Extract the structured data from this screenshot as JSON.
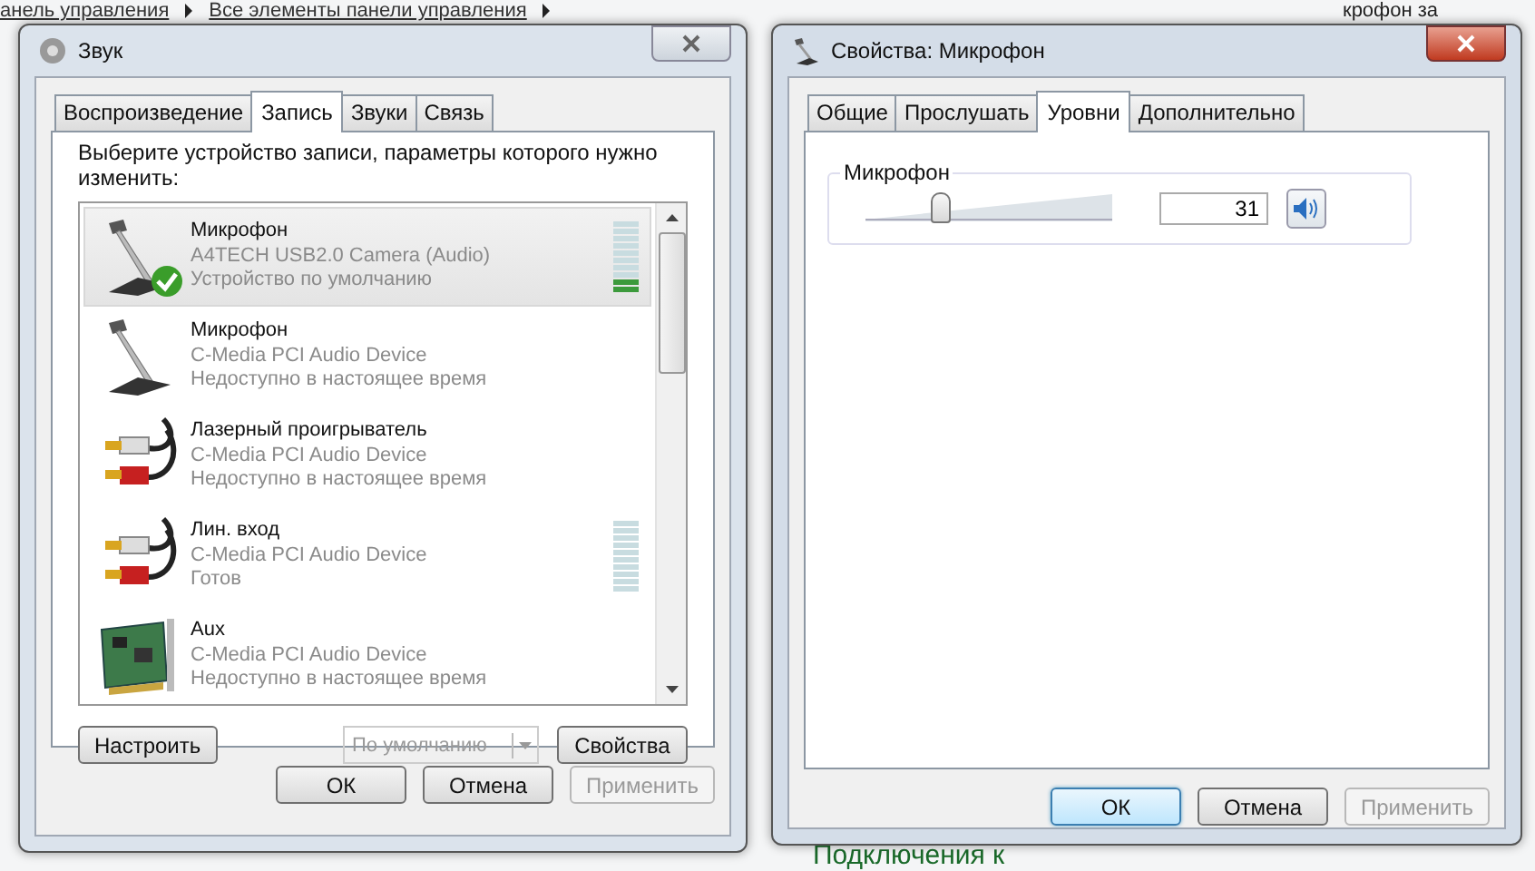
{
  "background": {
    "breadcrumb": [
      "анель управления",
      "Все элементы панели управления"
    ],
    "fragments": [
      {
        "text": "крофон за",
        "kind": "heading"
      },
      {
        "text": "Подключения к",
        "kind": "link"
      }
    ]
  },
  "sound_window": {
    "title": "Звук",
    "tabs": [
      {
        "label": "Воспроизведение",
        "selected": false
      },
      {
        "label": "Запись",
        "selected": true
      },
      {
        "label": "Звуки",
        "selected": false
      },
      {
        "label": "Связь",
        "selected": false
      }
    ],
    "instruction": "Выберите устройство записи, параметры которого нужно изменить:",
    "devices": [
      {
        "kind": "microphone",
        "name": "Микрофон",
        "device": "A4TECH USB2.0 Camera (Audio)",
        "status": "Устройство по умолчанию",
        "selected": true,
        "default": true,
        "meter": true,
        "level": 0.2
      },
      {
        "kind": "microphone",
        "name": "Микрофон",
        "device": "C-Media PCI Audio Device",
        "status": "Недоступно в настоящее время",
        "selected": false,
        "default": false,
        "meter": false
      },
      {
        "kind": "cable",
        "name": "Лазерный проигрыватель",
        "device": "C-Media PCI Audio Device",
        "status": "Недоступно в настоящее время",
        "selected": false,
        "default": false,
        "meter": false
      },
      {
        "kind": "cable",
        "name": "Лин. вход",
        "device": "C-Media PCI Audio Device",
        "status": "Готов",
        "selected": false,
        "default": false,
        "meter": true
      },
      {
        "kind": "card",
        "name": "Aux",
        "device": "C-Media PCI Audio Device",
        "status": "Недоступно в настоящее время",
        "selected": false,
        "default": false,
        "meter": false
      }
    ],
    "configure_button": {
      "label": "Настроить",
      "disabled": false
    },
    "default_dropdown": {
      "value": "По умолчанию",
      "disabled": true
    },
    "properties_button": {
      "label": "Свойства",
      "disabled": false
    },
    "buttons": [
      {
        "label": "ОК",
        "disabled": false,
        "focused": false
      },
      {
        "label": "Отмена",
        "disabled": false,
        "focused": false
      },
      {
        "label": "Применить",
        "disabled": true,
        "focused": false
      }
    ]
  },
  "properties_window": {
    "title": "Свойства: Микрофон",
    "tabs": [
      {
        "label": "Общие",
        "selected": false
      },
      {
        "label": "Прослушать",
        "selected": false
      },
      {
        "label": "Уровни",
        "selected": true
      },
      {
        "label": "Дополнительно",
        "selected": false
      }
    ],
    "levels": [
      {
        "label": "Микрофон",
        "level": 0.31,
        "value": "31",
        "muted": false
      }
    ],
    "buttons": [
      {
        "label": "ОК",
        "disabled": false,
        "focused": true
      },
      {
        "label": "Отмена",
        "disabled": false,
        "focused": false
      },
      {
        "label": "Применить",
        "disabled": true,
        "focused": false
      }
    ]
  }
}
